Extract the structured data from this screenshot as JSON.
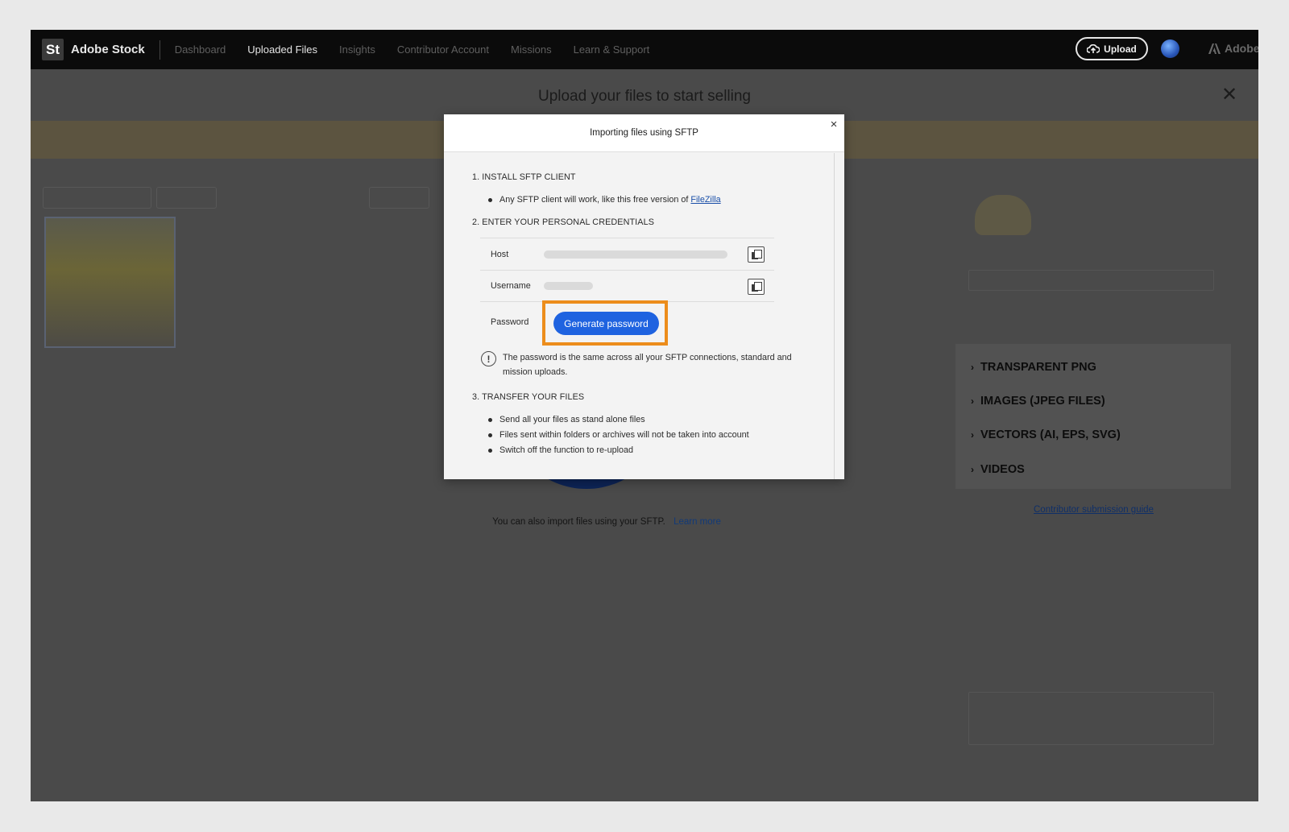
{
  "app": {
    "logo": "St",
    "brand": "Adobe Stock",
    "nav": [
      {
        "label": "Dashboard",
        "active": false
      },
      {
        "label": "Uploaded Files",
        "active": true
      },
      {
        "label": "Insights",
        "active": false
      },
      {
        "label": "Contributor Account",
        "active": false
      },
      {
        "label": "Missions",
        "active": false
      },
      {
        "label": "Learn & Support",
        "active": false
      }
    ],
    "upload_label": "Upload",
    "adobe_label": "Adobe"
  },
  "background": {
    "upload_heading": "Upload your files to start selling",
    "close_glyph": "✕",
    "sftp_text": "You can also import files using your SFTP.",
    "sftp_link": "Learn more",
    "dropdown": [
      "TRANSPARENT PNG",
      "IMAGES (JPEG FILES)",
      "VECTORS (AI, EPS, SVG)",
      "VIDEOS"
    ],
    "guide_link": "Contributor submission guide"
  },
  "modal": {
    "title": "Importing files using SFTP",
    "close_glyph": "×",
    "step1_title": "1. INSTALL SFTP CLIENT",
    "step1_bullet": "Any SFTP client will work, like this free version of",
    "step1_link": "FileZilla",
    "step2_title": "2. ENTER YOUR PERSONAL CREDENTIALS",
    "host_label": "Host",
    "username_label": "Username",
    "password_label": "Password",
    "generate_label": "Generate password",
    "info_text": "The password is the same across all your SFTP connections, standard and mission uploads.",
    "step3_title": "3. TRANSFER YOUR FILES",
    "step3_bullets": [
      "Send all your files as stand alone files",
      "Files sent within folders or archives will not be taken into account",
      "Switch off the function to re-upload"
    ]
  },
  "colors": {
    "highlight": "#ec8d1c",
    "primary_button": "#1f63e0",
    "link": "#1a4fa8"
  }
}
